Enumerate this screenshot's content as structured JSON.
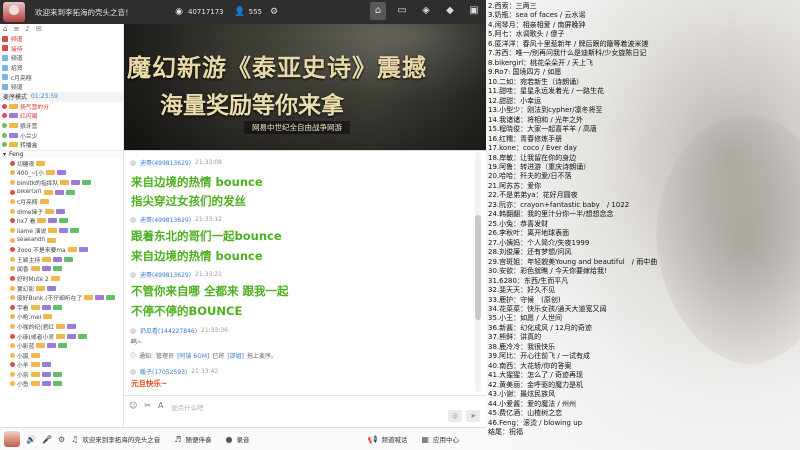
{
  "topbar": {
    "title": "欢迎来到李拓海的壳头之音！",
    "hot_count": "40717173",
    "user_count": "555",
    "icons": [
      "broadcast-icon",
      "user-icon",
      "settings-icon",
      "home-icon",
      "chat-icon",
      "gamepad-icon",
      "gift-icon",
      "screen-icon"
    ]
  },
  "left": {
    "toolbar_icons": [
      "home-icon",
      "list-icon",
      "voice-icon",
      "message-icon"
    ],
    "top_rows": [
      {
        "text": "频道",
        "color": "#d12f2f"
      },
      {
        "text": "接待",
        "color": "#d12f2f"
      },
      {
        "text": "频道",
        "color": "#444"
      },
      {
        "text": "招贤",
        "color": "#444"
      },
      {
        "text": "c月亮翔",
        "color": "#444"
      },
      {
        "text": "频道",
        "color": "#444"
      }
    ],
    "mic_label": "麦序模式",
    "mic_time": "01:23:59",
    "queue_rows": [
      {
        "text": "扬气营的分",
        "color": "#d12f2f"
      },
      {
        "text": "红闪阁",
        "color": "#d12f2f"
      },
      {
        "text": "狼牙营",
        "color": "#444"
      },
      {
        "text": "小兰少",
        "color": "#444"
      },
      {
        "text": "转播盒",
        "color": "#444"
      }
    ],
    "section_label": "Feng",
    "users": [
      "切糖夜",
      "400_~[小",
      "bimitk的指挥队",
      "bikerGirl",
      "c月亮翔",
      "dime婶子",
      "hx7 看",
      "liame 演说",
      "seaeahdn",
      "3ooo 不是来要ma",
      "王颖主持",
      "闻香",
      "好时Mute 2",
      "蒙幻影",
      "废好Bunk.(不仔细听在了",
      "宇看",
      "小枪.mei",
      "小咖的纪(君红",
      "小琢(或者小灵",
      "小影蓝",
      "小嵐",
      "小羊",
      "小奈",
      "小鱼"
    ]
  },
  "banner": {
    "title": "魔幻新游《泰亚史诗》震撼",
    "subtitle": "海量奖励等你来拿",
    "slogan": "网易中世纪全自由战争网游"
  },
  "chat": {
    "messages": [
      {
        "nick": "迪哥(499813629)",
        "time": "21:33:08",
        "text": "来自边境的热情 bounce"
      },
      {
        "nick": "",
        "time": "",
        "text": "指尖穿过女孩们的发丝"
      },
      {
        "nick": "迪哥(499813629)",
        "time": "21:33:12",
        "text": "跟着东北的哥们一起bounce"
      },
      {
        "nick": "",
        "time": "",
        "text": "来自边境的热情 bounce"
      },
      {
        "nick": "迪哥(499813629)",
        "time": "21:33:21",
        "text": "不管你来自哪 全都来 跟我一起"
      },
      {
        "nick": "",
        "time": "",
        "text": "不停不停的BOUNCE"
      }
    ],
    "small_msg_head": {
      "nick": "扔瓜看(144227846)",
      "time": "21:33:36"
    },
    "small_msg_text": "呜~",
    "system_msg": {
      "prefix": "通知:",
      "text1": "管理员",
      "name": "[阿瑞 6GM]",
      "text2": "已将",
      "target": "[邵姐]",
      "text3": "拖上麦序。"
    },
    "last_head": {
      "nick": "暖子(17052593)",
      "time": "21:33:42"
    },
    "last_text": "元旦快乐~"
  },
  "input": {
    "placeholder": "说点什么吧",
    "icons": [
      "emoji-icon",
      "scissors-icon",
      "font-icon"
    ]
  },
  "bottombar": {
    "greeting": "欢迎来到李拓海的壳头之音",
    "accompany": "随便伴奏",
    "record": "录音",
    "call": "频道喊话",
    "app": "应用中心"
  },
  "rightpanel": {
    "lines": [
      "2.西索：三两三",
      "3.奶瓶：sea of faces / 云水谣",
      "4.闲琴月：相亲相爱 / 南屏晚钟",
      "5.阿七：水调歌头 / 傻子",
      "6.匿洋洋：春风十里惹新年 / 牌后跟的簸等着波米搓",
      "7.苏西：唯一/别再问我什么是迪斯科/少女旋陈日记",
      "8.bikergirl：桃花朵朵开 / 天上飞",
      "9.Ro7: 国境四方 / 如愿",
      "10.二如：宛若新生（诗朗诵）",
      "11.甜哇：星星永远发着光 / 一路生花",
      "12.甜甜：小幸运",
      "13.小型少：刚法到cypher/凛冬将至",
      "14.我诸诸：将相和 / 光年之外",
      "15.程晓俊：大家一起喜羊羊 / 高唐",
      "16.红糯：青春修炼手册",
      "17.kone：coco / Ever day",
      "18.岸敏：让我留在你的身边",
      "19.阿鲁：转进游（重庆诗朗诵）",
      "20.哈哈：歼夫的爱/日不落",
      "21.阿苏苏：爱你",
      "22.不是弟弟ya：花好月圆夜",
      "23.阮亦：crayon+fantastic baby　/ 1022",
      "24.韩翻翻：我的里汁分你一半/想想念念",
      "25.小兔：恭喜发财",
      "26.李秋叶：离开地球表面",
      "27.小姨妈：个人简介/失夜1999",
      "28.刘俊廉：还有梦想/问风",
      "29.宫斑姐：年轻貌美Young and beautiful　/ 雨中曲",
      "30.安欲：彩色就瞧 / 今天你要嫁给我!",
      "31.6280：东西/生而平凡",
      "32.斐天天：好久不见",
      "33.鹿护：守候　(原创)",
      "34.花菜菜：快乐女孩/通天大道宽又阔",
      "35.小王：如愿 / 人世间",
      "36.新酱：幻化成风 / 12月的奇迹",
      "37.熊鲜：讲真的",
      "38.鹿冷冷：我很快乐",
      "39.阿比：开心往前飞 / 一试有成",
      "40.南西：大花轿/你的答案",
      "41.大猩猩：怎么了 / 奇迹再现",
      "42.黄美丽：金呼驱的魔力是机",
      "43.小谢：最炫民族风",
      "44.小爱酱：爱的魔法 / 州州",
      "45.费亿酒：山楂树之恋",
      "46.Feng：滚烫 / blowing up",
      "结尾：祝福"
    ]
  }
}
